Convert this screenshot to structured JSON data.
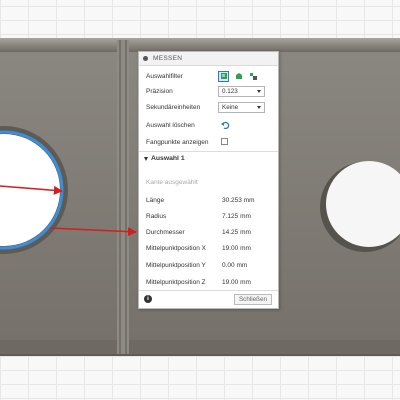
{
  "panel": {
    "title": "MESSEN",
    "rows": {
      "selection_filter": "Auswahlfilter",
      "precision_label": "Präzision",
      "precision_value": "0.123",
      "secondary_units_label": "Sekundäreinheiten",
      "secondary_units_value": "Keine",
      "clear_selection": "Auswahl löschen",
      "show_snap_points": "Fangpunkte anzeigen"
    },
    "section": {
      "title": "Auswahl 1",
      "no_edge_selected": "Kante ausgewählt",
      "measurements": [
        {
          "label": "Länge",
          "value": "30.253 mm"
        },
        {
          "label": "Radius",
          "value": "7.125 mm"
        },
        {
          "label": "Durchmesser",
          "value": "14.25 mm"
        },
        {
          "label": "Mittelpunktposition X",
          "value": "19.00 mm"
        },
        {
          "label": "Mittelpunktposition Y",
          "value": "0.00 mm"
        },
        {
          "label": "Mittelpunktposition Z",
          "value": "19.00 mm"
        }
      ]
    },
    "footer": {
      "info": "i",
      "close": "Schließen"
    }
  },
  "colors": {
    "model_face": "#7b7770",
    "arrow": "#d21e1e",
    "accent": "#2c79c8",
    "filter_green": "#2e9e58"
  },
  "icons": [
    "body-filter-icon",
    "face-filter-icon",
    "component-filter-icon",
    "reset-icon",
    "info-icon"
  ]
}
